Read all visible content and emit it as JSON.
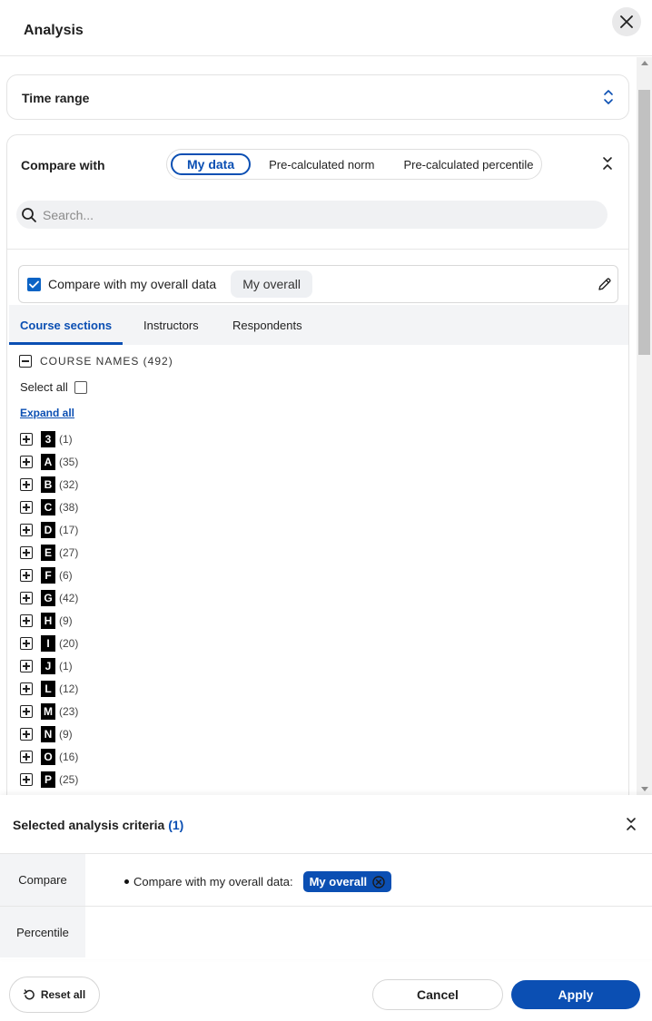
{
  "header": {
    "title": "Analysis",
    "close_icon": "close-icon"
  },
  "time_range": {
    "label": "Time range"
  },
  "compare": {
    "label": "Compare with",
    "segments": [
      "My data",
      "Pre-calculated norm",
      "Pre-calculated percentile"
    ],
    "selected_segment": "My data",
    "search_placeholder": "Search...",
    "overall_checkbox_label": "Compare with my overall data",
    "overall_checked": true,
    "overall_chip": "My overall"
  },
  "tabs": [
    "Course sections",
    "Instructors",
    "Respondents"
  ],
  "tree": {
    "heading": "COURSE NAMES (492)",
    "select_all": "Select all",
    "expand_all": "Expand all",
    "groups": [
      {
        "letter": "3",
        "count": "(1)"
      },
      {
        "letter": "A",
        "count": "(35)"
      },
      {
        "letter": "B",
        "count": "(32)"
      },
      {
        "letter": "C",
        "count": "(38)"
      },
      {
        "letter": "D",
        "count": "(17)"
      },
      {
        "letter": "E",
        "count": "(27)"
      },
      {
        "letter": "F",
        "count": "(6)"
      },
      {
        "letter": "G",
        "count": "(42)"
      },
      {
        "letter": "H",
        "count": "(9)"
      },
      {
        "letter": "I",
        "count": "(20)"
      },
      {
        "letter": "J",
        "count": "(1)"
      },
      {
        "letter": "L",
        "count": "(12)"
      },
      {
        "letter": "M",
        "count": "(23)"
      },
      {
        "letter": "N",
        "count": "(9)"
      },
      {
        "letter": "O",
        "count": "(16)"
      },
      {
        "letter": "P",
        "count": "(25)"
      }
    ]
  },
  "criteria": {
    "title": "Selected analysis criteria",
    "count": "(1)",
    "rows": {
      "compare_key": "Compare",
      "compare_value": "Compare with my overall data:",
      "compare_chip": "My overall",
      "percentile_key": "Percentile"
    }
  },
  "footer": {
    "reset": "Reset all",
    "cancel": "Cancel",
    "apply": "Apply"
  },
  "colors": {
    "accent": "#0b4fb3",
    "checkbox": "#0b63c5"
  }
}
